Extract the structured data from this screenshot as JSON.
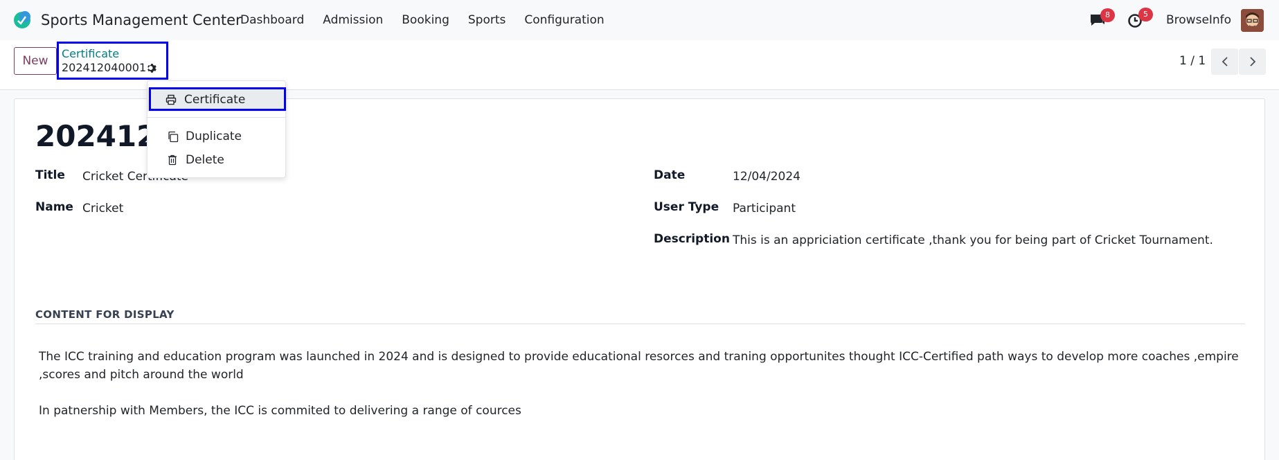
{
  "app": {
    "title": "Sports Management Center",
    "menu": [
      "Dashboard",
      "Admission",
      "Booking",
      "Sports",
      "Configuration"
    ]
  },
  "systray": {
    "messages_count": "8",
    "activities_count": "5",
    "user_name": "BrowseInfo"
  },
  "control": {
    "new_label": "New",
    "breadcrumb_parent": "Certificate",
    "breadcrumb_current": "202412040001",
    "pager": "1 / 1"
  },
  "dropdown": {
    "print_item": "Certificate",
    "duplicate": "Duplicate",
    "delete": "Delete"
  },
  "form": {
    "record_title": "202412040001",
    "title_label": "Title",
    "title_value": "Cricket Certificate",
    "name_label": "Name",
    "name_value": "Cricket",
    "date_label": "Date",
    "date_value": "12/04/2024",
    "user_type_label": "User Type",
    "user_type_value": "Participant",
    "description_label": "Description",
    "description_value": "This is an appriciation certificate ,thank you for being part of Cricket Tournament.",
    "section_title": "CONTENT FOR DISPLAY",
    "para1": "The ICC training and education program was launched in 2024 and is designed to provide educational resorces and traning opportunites thought ICC-Certified path ways to develop more coaches ,empire ,scores and pitch around the world",
    "para2": "In patnership with Members, the ICC is commited to delivering a range of cources"
  },
  "colors": {
    "brand": "#7a3e5f",
    "link": "#017e84",
    "badge": "#dc3545",
    "highlight_box": "#0000ee"
  },
  "icons": [
    "app-logo-icon",
    "chat-icon",
    "clock-icon",
    "gear-icon",
    "chevron-left-icon",
    "chevron-right-icon",
    "printer-icon",
    "copy-icon",
    "trash-icon"
  ]
}
